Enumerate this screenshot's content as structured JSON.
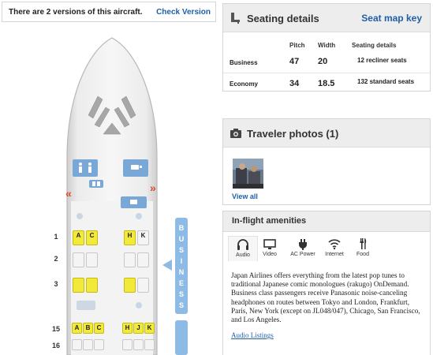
{
  "version_bar": {
    "text": "There are 2 versions of this aircraft.",
    "link": "Check Version"
  },
  "seat_map": {
    "rows": [
      {
        "num": "1",
        "left": [
          {
            "l": "A",
            "c": "y"
          },
          {
            "l": "C",
            "c": "y"
          }
        ],
        "right": [
          {
            "l": "H",
            "c": "y"
          },
          {
            "l": "K",
            "c": "w"
          }
        ]
      },
      {
        "num": "2",
        "left": [
          {
            "l": "",
            "c": "w"
          },
          {
            "l": "",
            "c": "w"
          }
        ],
        "right": [
          {
            "l": "",
            "c": "w"
          },
          {
            "l": "",
            "c": "w"
          }
        ]
      },
      {
        "num": "3",
        "left": [
          {
            "l": "",
            "c": "y"
          },
          {
            "l": "",
            "c": "y"
          }
        ],
        "right": [
          {
            "l": "",
            "c": "y"
          },
          {
            "l": "",
            "c": "w"
          }
        ]
      },
      {
        "num": "15",
        "left": [
          {
            "l": "A",
            "c": "y"
          },
          {
            "l": "B",
            "c": "y"
          },
          {
            "l": "C",
            "c": "y"
          }
        ],
        "right": [
          {
            "l": "H",
            "c": "y"
          },
          {
            "l": "J",
            "c": "y"
          },
          {
            "l": "K",
            "c": "y"
          }
        ]
      },
      {
        "num": "16",
        "left": [
          {
            "l": "",
            "c": "w"
          },
          {
            "l": "",
            "c": "w"
          },
          {
            "l": "",
            "c": "w"
          }
        ],
        "right": [
          {
            "l": "",
            "c": "w"
          },
          {
            "l": "",
            "c": "w"
          },
          {
            "l": "",
            "c": "w"
          }
        ]
      }
    ],
    "cabin_label": [
      "B",
      "U",
      "S",
      "I",
      "N",
      "E",
      "S",
      "S"
    ],
    "exit_marker": "«",
    "exit_marker_right": "»",
    "colors": {
      "seat_yellow": "#f2e93a",
      "cabin_blue": "#8ebbe6",
      "exit_red": "#d84a2c"
    }
  },
  "seating": {
    "title": "Seating details",
    "link": "Seat map key",
    "icon": "seat-icon",
    "headers": {
      "pitch": "Pitch",
      "width": "Width",
      "details": "Seating details"
    },
    "rows": [
      {
        "class": "Business",
        "pitch": "47",
        "width": "20",
        "details": "12 recliner seats"
      },
      {
        "class": "Economy",
        "pitch": "34",
        "width": "18.5",
        "details": "132 standard seats"
      }
    ]
  },
  "photos": {
    "title": "Traveler photos (1)",
    "link": "View all",
    "icon": "camera-icon"
  },
  "amenities": {
    "title": "In-flight amenities",
    "tabs": [
      {
        "label": "Audio",
        "icon": "headphones-icon",
        "active": true
      },
      {
        "label": "Video",
        "icon": "monitor-icon",
        "active": false
      },
      {
        "label": "AC Power",
        "icon": "plug-icon",
        "active": false
      },
      {
        "label": "Internet",
        "icon": "wifi-icon",
        "active": false
      },
      {
        "label": "Food",
        "icon": "utensils-icon",
        "active": false
      }
    ],
    "body": "Japan Airlines offers everything from the latest pop tunes to traditional Japanese comic monologues (rakugo) OnDemand. Business class passengers receive Panasonic noise-canceling headphones on routes between Tokyo and London, Frankfurt, Paris, New York (except on JL048/047), Chicago, San Francisco, and Los Angeles.",
    "link": "Audio Listings"
  }
}
